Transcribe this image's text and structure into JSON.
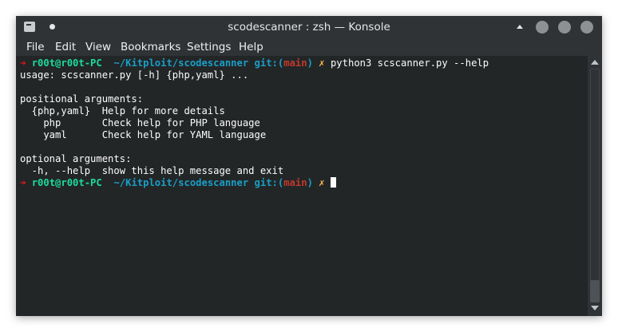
{
  "window": {
    "title": "scodescanner : zsh — Konsole"
  },
  "titlebar_icons": {
    "app": "konsole-app-icon",
    "pin": "pin-dot-icon",
    "keep_above": "keep-above-icon",
    "minimize": "minimize-icon",
    "maximize": "maximize-icon",
    "close": "close-icon"
  },
  "menu": {
    "items": [
      "File",
      "Edit",
      "View",
      "Bookmarks",
      "Settings",
      "Help"
    ]
  },
  "prompt": {
    "arrow": "➜",
    "user_host": "r00t@r00t-PC",
    "path": "~/Kitploit/scodescanner",
    "git_label": "git:(",
    "branch": "main",
    "git_close": ")",
    "dirty_mark": "✗"
  },
  "terminal": {
    "command": "python3 scscanner.py --help",
    "output": [
      "usage: scscanner.py [-h] {php,yaml} ...",
      "",
      "positional arguments:",
      "  {php,yaml}  Help for more details",
      "    php       Check help for PHP language",
      "    yaml      Check help for YAML language",
      "",
      "optional arguments:",
      "  -h, --help  show this help message and exit"
    ]
  },
  "colors": {
    "terminal_bg": "#232627",
    "chrome_bg": "#2f3336",
    "prompt_arrow": "#ed1515",
    "prompt_user": "#1cdc9a",
    "prompt_path": "#1b9ec6",
    "prompt_branch": "#c0392b",
    "prompt_dirty": "#fdbc4b"
  }
}
